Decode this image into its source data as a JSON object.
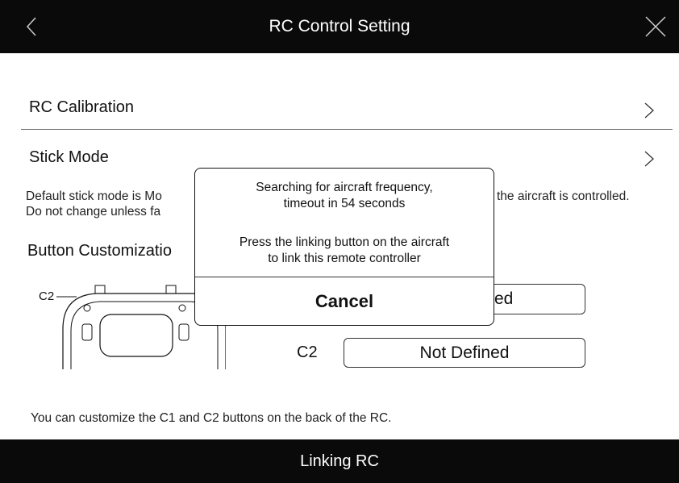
{
  "header": {
    "title": "RC Control Setting",
    "back_icon": "chevron-left-icon",
    "close_icon": "close-icon"
  },
  "rows": {
    "calibration": "RC Calibration",
    "stick_mode": "Stick Mode"
  },
  "stick_desc": {
    "line1_left": "Default stick mode is Mo",
    "line1_right": "the aircraft is controlled.",
    "line2_left": "Do not change unless fa"
  },
  "button_section": "Button Customizatio",
  "buttons": {
    "c1_value_visible": "ed",
    "c2_label": "C2",
    "c2_value": "Not Defined",
    "illus_c2_label": "C2"
  },
  "footnote": "You can customize the C1 and C2 buttons on the back of the RC.",
  "bottom": {
    "label": "Linking RC"
  },
  "modal": {
    "line1": "Searching for aircraft frequency,",
    "line2": "timeout in 54 seconds",
    "line3": "Press the linking button on the aircraft",
    "line4": "to link this remote controller",
    "cancel": "Cancel"
  }
}
